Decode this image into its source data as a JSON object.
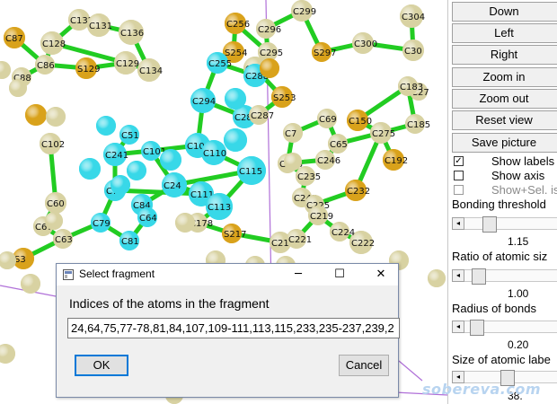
{
  "viewport": {
    "atom_labels": [
      "C87",
      "C128",
      "C132",
      "C131",
      "C136",
      "C256",
      "C289",
      "C299",
      "C304",
      "S129",
      "C88",
      "C86",
      "C129",
      "C134",
      "S254",
      "C296",
      "S297",
      "C300",
      "C30",
      "C255",
      "C288",
      "S253",
      "C295",
      "C294",
      "C285",
      "C287",
      "C27",
      "C7",
      "C69",
      "C150",
      "C183",
      "C185",
      "C65",
      "C275",
      "C192",
      "C241",
      "C101",
      "C109",
      "C110",
      "C115",
      "C111",
      "C113",
      "C24",
      "C51",
      "C75",
      "C233",
      "C235",
      "C232",
      "C246",
      "C245",
      "C225",
      "C60",
      "C67",
      "C63",
      "C79",
      "C84",
      "C64",
      "C81",
      "C178",
      "S3",
      "C212",
      "C219",
      "C222",
      "S217",
      "C221",
      "C224",
      "C102"
    ]
  },
  "panel": {
    "buttons": [
      "Down",
      "Left",
      "Right",
      "Zoom in",
      "Zoom out",
      "Reset view",
      "Save picture"
    ],
    "checkboxes": [
      {
        "label": "Show labels",
        "checked": true,
        "mark": "✓"
      },
      {
        "label": "Show axis",
        "checked": false,
        "mark": ""
      },
      {
        "label": "Show+Sel. isosu",
        "checked": false,
        "mark": ""
      }
    ],
    "sliders": [
      {
        "label": "Bonding threshold",
        "value": "1.15"
      },
      {
        "label": "Ratio of atomic siz",
        "value": "1.00"
      },
      {
        "label": "Radius of bonds",
        "value": "0.20"
      },
      {
        "label": "Size of atomic labe",
        "value": "38."
      }
    ],
    "arrow_glyph": "◂"
  },
  "watermark": "sobereva.com",
  "dialog": {
    "title": "Select fragment",
    "prompt": "Indices of the atoms in the fragment",
    "value": "24,64,75,77-78,81,84,107,109-111,113,115,233,235-237,239,2",
    "ok_label": "OK",
    "cancel_label": "Cancel",
    "minimize_glyph": "─",
    "maximize_glyph": "☐",
    "close_glyph": "✕"
  },
  "colors": {
    "carbon": "#d8d2a2",
    "sulfur": "#d9a21b",
    "fragment": "#38d8e8",
    "bond": "#22cc22",
    "unit_cell": "#b070d8",
    "watermark": "#b8d4f0",
    "dialog_accent": "#0078d7"
  }
}
